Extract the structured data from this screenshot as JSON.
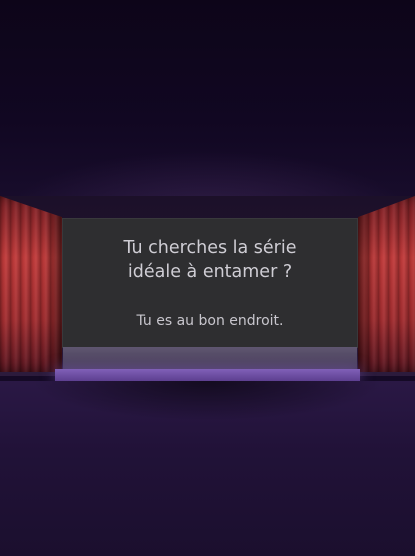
{
  "scene": {
    "headline_line1": "Tu cherches la série",
    "headline_line2": "idéale à entamer ?",
    "subline": "Tu es au bon endroit."
  },
  "colors": {
    "background": "#150a26",
    "screen": "#2e2e30",
    "curtain": "#c23a3a",
    "stage_edge": "#8060b8",
    "text": "#cfcdd4"
  }
}
